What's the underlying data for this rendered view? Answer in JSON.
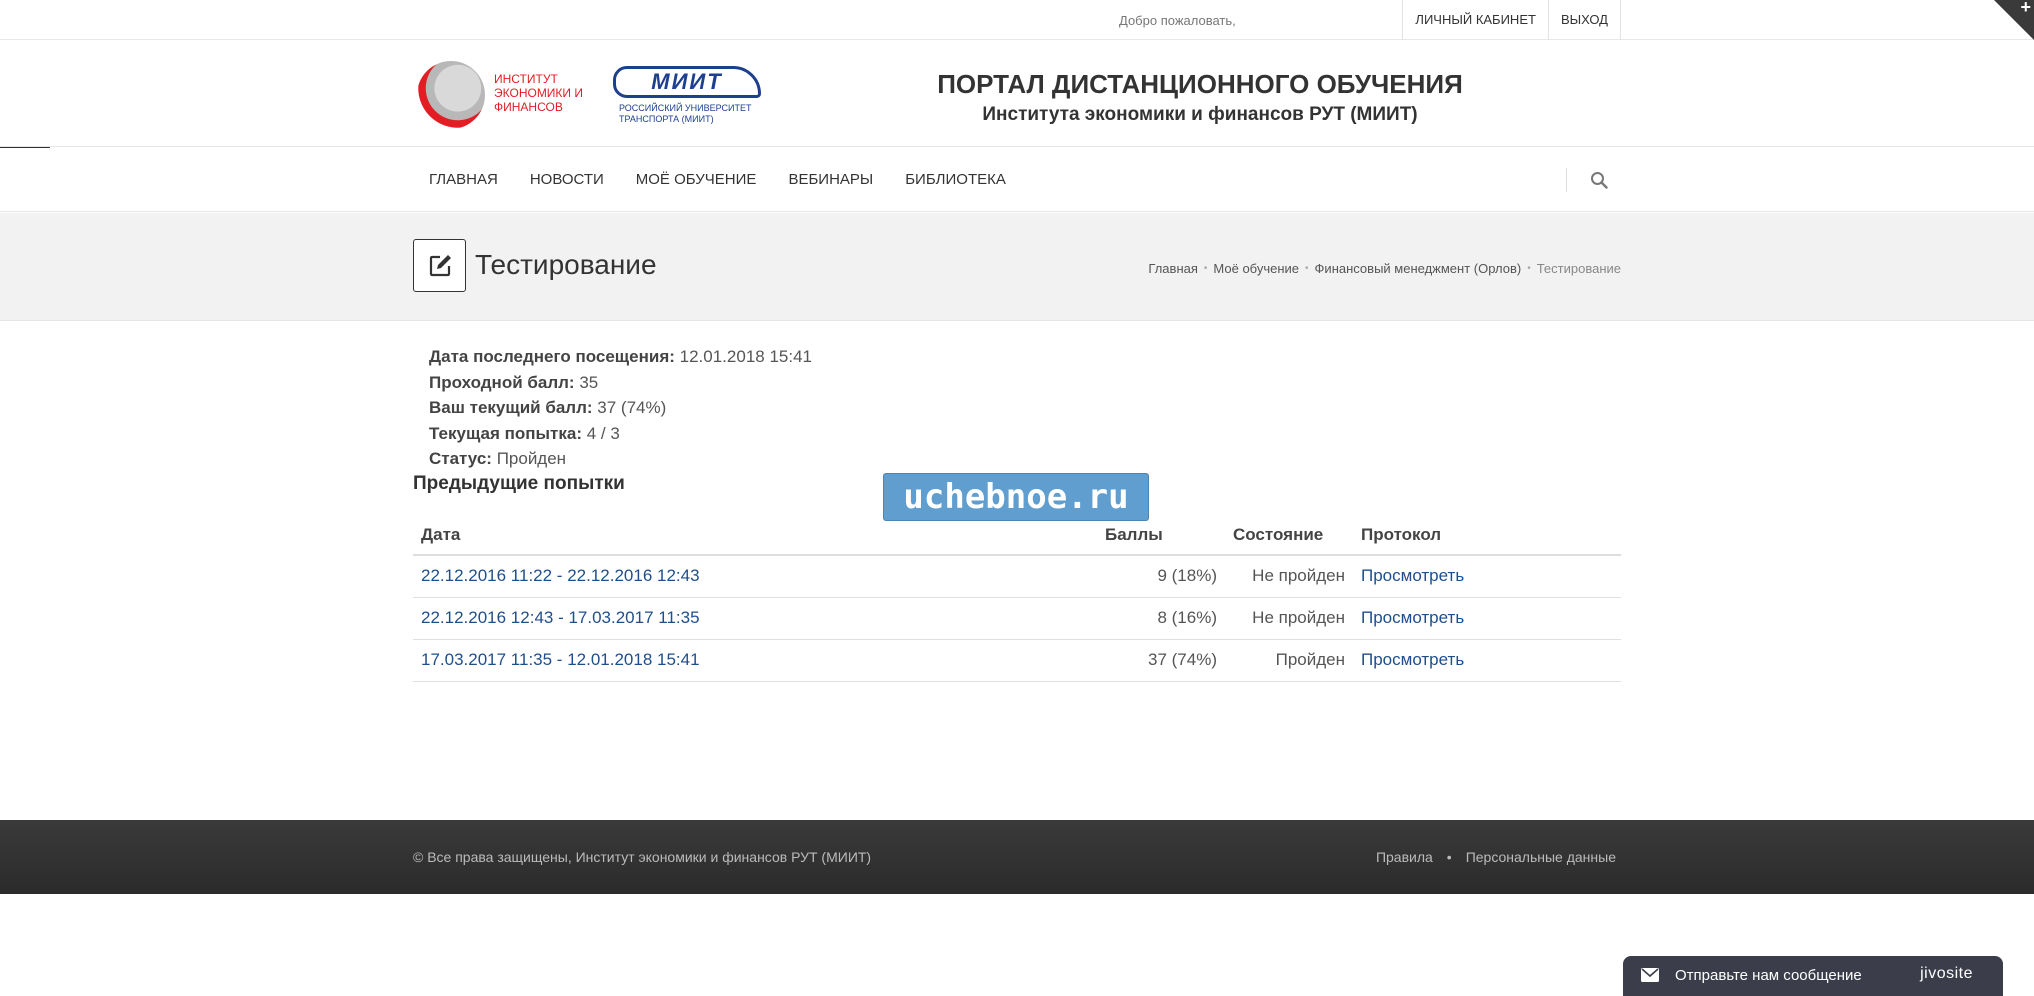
{
  "topbar": {
    "welcome": "Добро пожаловать,",
    "account_link": "ЛИЧНЫЙ КАБИНЕТ",
    "logout_link": "ВЫХОД"
  },
  "header": {
    "logo_institute_lines": [
      "ИНСТИТУТ",
      "ЭКОНОМИКИ И",
      "ФИНАНСОВ"
    ],
    "logo_miit_mark": "МИИТ",
    "logo_miit_sub_lines": [
      "РОССИЙСКИЙ УНИВЕРСИТЕТ",
      "ТРАНСПОРТА (МИИТ)"
    ],
    "title": "ПОРТАЛ ДИСТАНЦИОННОГО ОБУЧЕНИЯ",
    "subtitle": "Института экономики и финансов РУТ (МИИТ)"
  },
  "nav": {
    "items": [
      {
        "label": "ГЛАВНАЯ"
      },
      {
        "label": "НОВОСТИ"
      },
      {
        "label": "МОЁ ОБУЧЕНИЕ"
      },
      {
        "label": "ВЕБИНАРЫ"
      },
      {
        "label": "БИБЛИОТЕКА"
      }
    ]
  },
  "page": {
    "title": "Тестирование",
    "breadcrumb": [
      "Главная",
      "Моё обучение",
      "Финансовый менеджмент (Орлов)",
      "Тестирование"
    ]
  },
  "info": {
    "last_visit_label": "Дата последнего посещения:",
    "last_visit_value": "12.01.2018 15:41",
    "pass_score_label": "Проходной балл:",
    "pass_score_value": "35",
    "current_score_label": "Ваш текущий балл:",
    "current_score_value": "37 (74%)",
    "attempt_label": "Текущая попытка:",
    "attempt_value": "4 / 3",
    "status_label": "Статус:",
    "status_value": "Пройден"
  },
  "attempts": {
    "title": "Предыдущие попытки",
    "headers": [
      "Дата",
      "Баллы",
      "Состояние",
      "Протокол"
    ],
    "rows": [
      {
        "date": "22.12.2016 11:22 - 22.12.2016 12:43",
        "score": "9 (18%)",
        "state": "Не пройден",
        "protocol": "Просмотреть"
      },
      {
        "date": "22.12.2016 12:43 - 17.03.2017 11:35",
        "score": "8 (16%)",
        "state": "Не пройден",
        "protocol": "Просмотреть"
      },
      {
        "date": "17.03.2017 11:35 - 12.01.2018 15:41",
        "score": "37 (74%)",
        "state": "Пройден",
        "protocol": "Просмотреть"
      }
    ]
  },
  "watermark": "uchebnoe.ru",
  "footer": {
    "copyright": "© Все права защищены, Институт экономики и финансов РУТ (МИИТ)",
    "links": [
      "Правила",
      "Персональные данные"
    ],
    "separator": "•"
  },
  "chat": {
    "message": "Отправьте нам сообщение",
    "brand": "jivosite"
  },
  "colors": {
    "link": "#1f4e8c",
    "footer_bg": "#333333",
    "titlebar_bg": "#f2f2f2",
    "logo_red": "#e21d24",
    "logo_blue": "#1d3f8f",
    "chat_bg": "#3b3d4a"
  },
  "icons": {
    "corner": "plus-icon",
    "lab_tab": "flask-icon",
    "search": "search-icon",
    "page": "edit-icon",
    "chat": "mail-icon"
  }
}
